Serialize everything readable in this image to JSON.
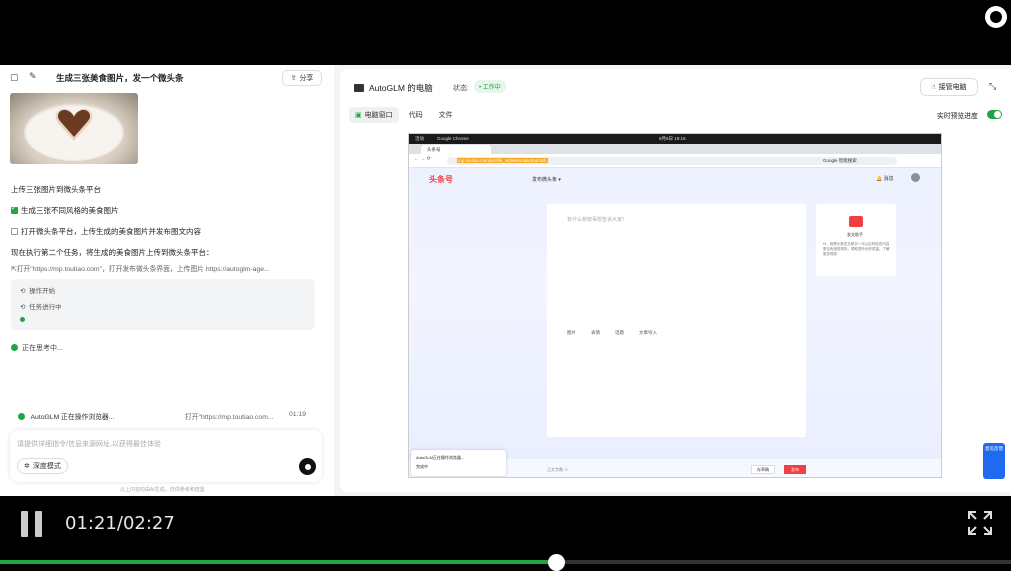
{
  "chat": {
    "title": "生成三张美食图片，发一个微头条",
    "share_label": "分享",
    "messages": {
      "upload_line": "上传三张图片到微头条平台",
      "task1": "生成三张不同风格的美食图片",
      "task2": "打开微头条平台，上传生成的美食图片并发布图文内容",
      "executing": "现在执行第二个任务，将生成的美食图片上传到微头条平台：",
      "action_detail": "打开\"https://mp.toutiao.com\"，打开发布微头条界面，上传图片 https://autoglm-age..."
    },
    "steps": [
      "操作开始",
      "任务进行中"
    ],
    "thinking": "正在思考中...",
    "status_bar": {
      "label": "AutoGLM 正在操作浏览器...",
      "detail": "打开\"https://mp.toutiao.com...",
      "time": "01:19"
    },
    "input": {
      "placeholder": "请提供详细指令/信息来源网址,以获得最佳体验",
      "deep_mode": "深度模式"
    },
    "footer": "以上内容均由AI生成，仅供参考和借鉴"
  },
  "computer": {
    "title": "AutoGLM 的电脑",
    "status_label": "状态:",
    "status_value": "• 工作中",
    "takeover": "接管电脑",
    "tabs": [
      "电脑窗口",
      "代码",
      "文件"
    ],
    "live_label": "实时预览进度",
    "live_on": true
  },
  "desktop": {
    "topbar_left": "活动",
    "topbar_app": "Google Chrome",
    "clock": "8月8日 19:15",
    "browser_tab": "头条号",
    "url": "mp.toutiao.com/profile_v4/weitoutiao/publish",
    "search_engine": "Google 智能搜索",
    "site_logo": "头条号",
    "publish_menu": "发布微头条 ▾",
    "bell": "消息",
    "editor_placeholder": "有什么新鲜事想告诉大家？",
    "editor_tools": [
      "图片",
      "表情",
      "话题",
      "文章导入"
    ],
    "helper_title": "发文助手",
    "helper_text": "Hi，我是头条发文助手～可以实时检查内容是否有违规风险，帮助提升创作质量。了解更多规则",
    "overlay_line1": "AutoGLM正在操作浏览器...",
    "overlay_line2": "完成中",
    "draft_btn": "存草稿",
    "publish_btn": "发布",
    "word_count": "正文字数: 0",
    "side_float": "意见反馈"
  },
  "player": {
    "time": "01:21/02:27",
    "progress": 0.55
  },
  "colors": {
    "accent_green": "#22a447",
    "toutiao_red": "#f04142"
  }
}
